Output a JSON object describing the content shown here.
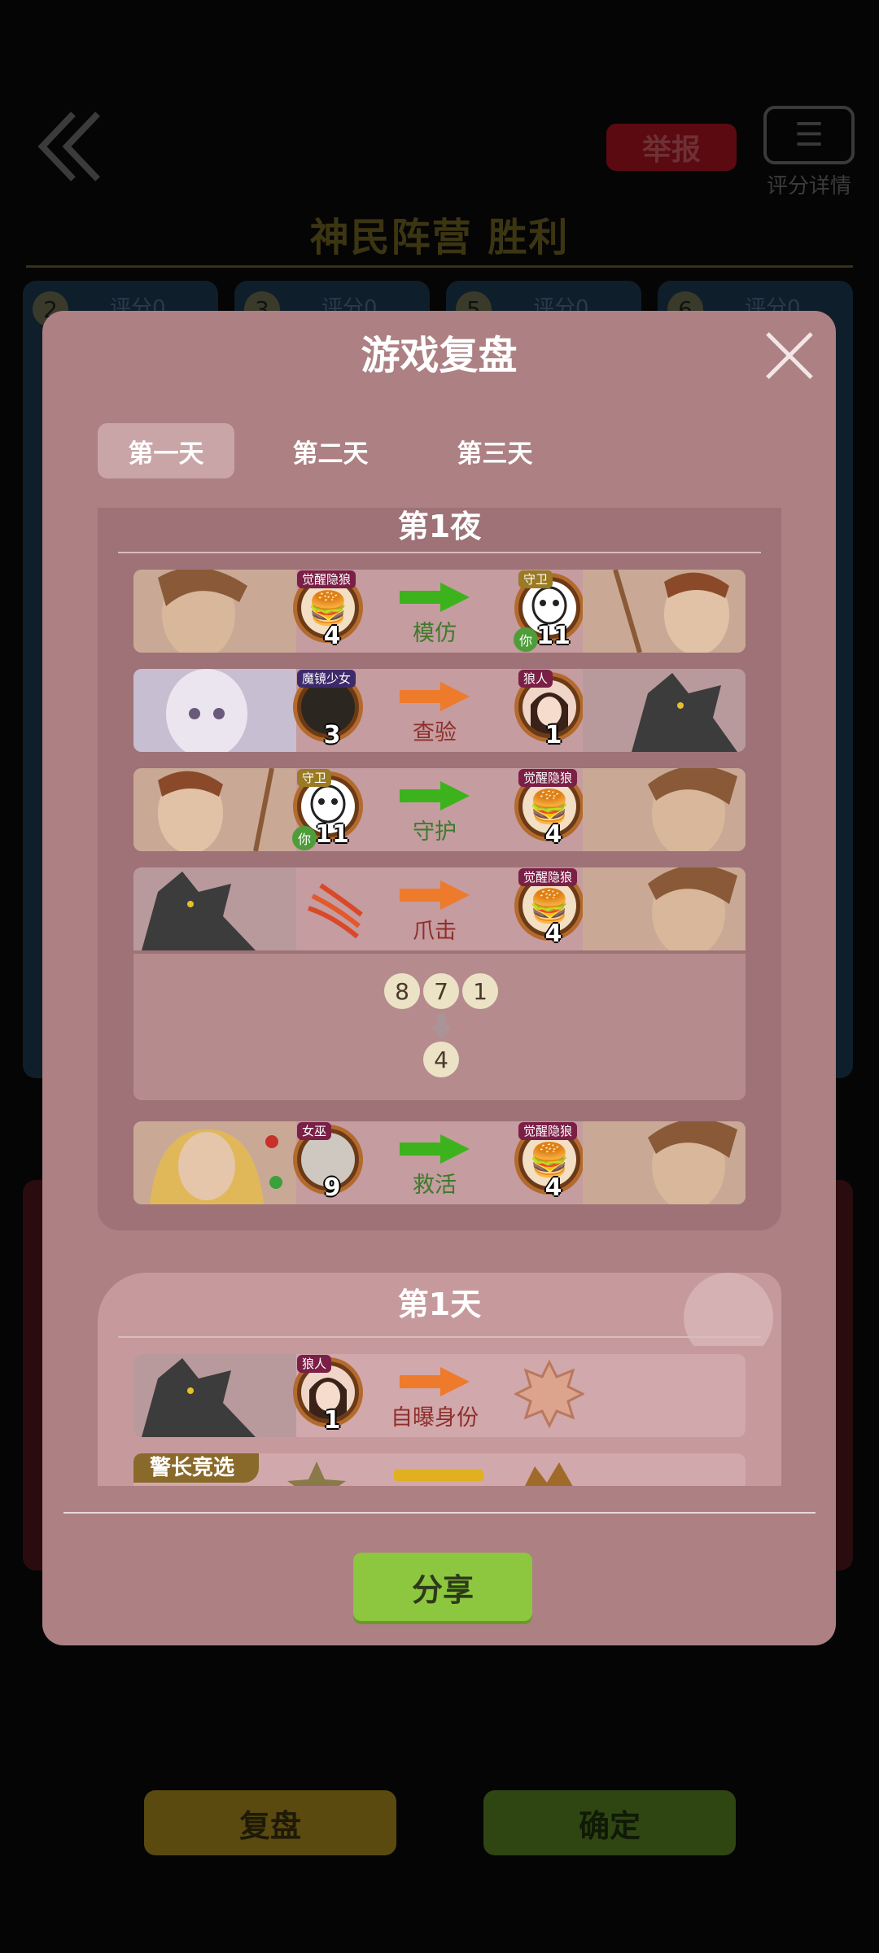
{
  "background": {
    "report_label": "举报",
    "score_detail_label": "评分详情",
    "result_title": "神民阵营  胜利",
    "card_scores": [
      "评分0",
      "评分0",
      "评分0",
      "评分0"
    ],
    "card_numbers": [
      "2",
      "3",
      "5",
      "6"
    ],
    "replay_button": "复盘",
    "confirm_button": "确定"
  },
  "modal": {
    "title": "游戏复盘",
    "tabs": [
      {
        "label": "第一天",
        "active": true
      },
      {
        "label": "第二天",
        "active": false
      },
      {
        "label": "第三天",
        "active": false
      }
    ],
    "night": {
      "title": "第1夜",
      "actions": [
        {
          "actor_role": "觉醒隐狼",
          "actor_num": "4",
          "verb": "模仿",
          "target_role": "守卫",
          "target_num": "11",
          "target_you": "你"
        },
        {
          "actor_role": "魔镜少女",
          "actor_num": "3",
          "verb": "查验",
          "target_role": "狼人",
          "target_num": "1"
        },
        {
          "actor_role": "守卫",
          "actor_num": "11",
          "actor_you": "你",
          "verb": "守护",
          "target_role": "觉醒隐狼",
          "target_num": "4"
        },
        {
          "verb": "爪击",
          "target_role": "觉醒隐狼",
          "target_num": "4"
        },
        {
          "actor_role": "女巫",
          "actor_num": "9",
          "verb": "救活",
          "target_role": "觉醒隐狼",
          "target_num": "4"
        }
      ],
      "votes_from": [
        "8",
        "7",
        "1"
      ],
      "votes_to": "4"
    },
    "day": {
      "title": "第1天",
      "actions": [
        {
          "actor_role": "狼人",
          "actor_num": "1",
          "verb": "自曝身份"
        }
      ],
      "sheriff_label": "警长竞选"
    },
    "share_button": "分享"
  },
  "colors": {
    "modal_bg": "#ad8083",
    "arrow_green": "#3cb31c",
    "arrow_orange": "#ee7a2c",
    "share_green": "#8dc63f"
  }
}
